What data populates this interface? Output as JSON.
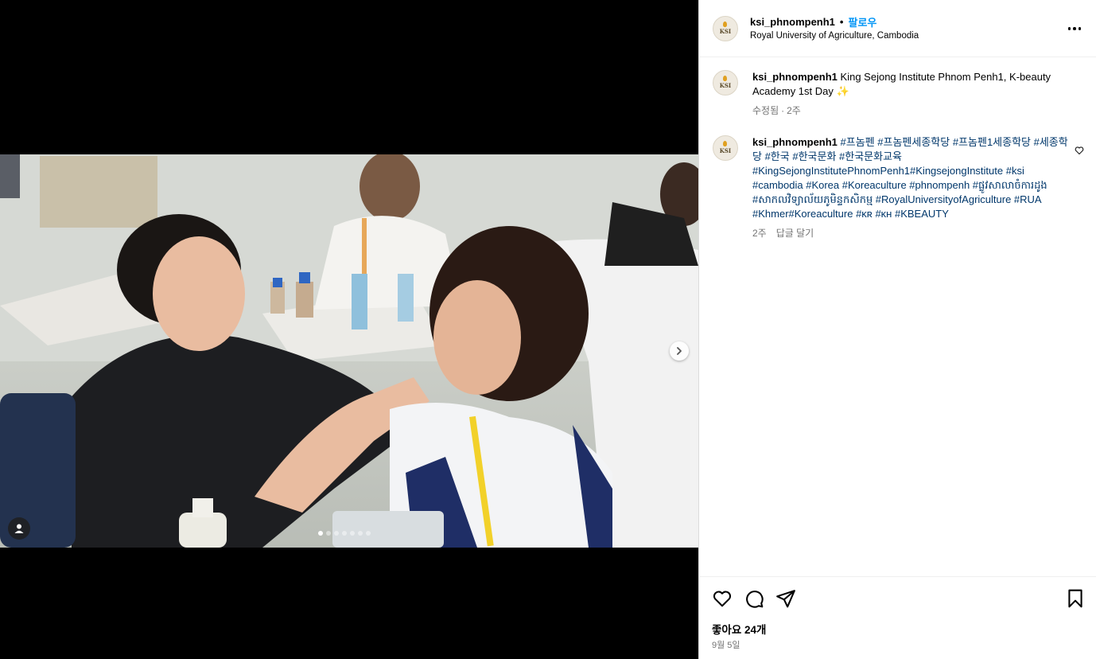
{
  "post": {
    "username": "ksi_phnompenh1",
    "separator": "•",
    "follow_label": "팔로우",
    "location": "Royal University of Agriculture, Cambodia",
    "avatar_text": "KSI"
  },
  "caption": {
    "username": "ksi_phnompenh1",
    "text": "King Sejong Institute Phnom Penh1, K-beauty Academy 1st Day ✨",
    "edited": "수정됨",
    "meta_sep": "·",
    "age": "2주"
  },
  "hashtag_comment": {
    "username": "ksi_phnompenh1",
    "tags": "#프놈펜 #프놈펜세종학당 #프놈펜1세종학당 #세종학당 #한국 #한국문화 #한국문화교육 #KingSejongInstitutePhnomPenh1#KingsejongInstitute #ksi #cambodia #Korea #Koreaculture #phnompenh #ផ្លូវសាលាចំការដូង #សាកលវិទ្យាល័យភូមិន្ទកសិកម្ម #RoyalUniversityofAgriculture #RUA #Khmer#Koreaculture #ᴋʀ #ᴋʜ #KBEAUTY",
    "age": "2주",
    "reply_label": "답글 달기"
  },
  "stats": {
    "likes": "좋아요 24개",
    "date": "9월 5일"
  },
  "carousel": {
    "total": 7,
    "active_index": 0
  },
  "icons": {
    "like": "heart-icon",
    "comment": "comment-icon",
    "share": "paper-plane-icon",
    "save": "bookmark-icon",
    "more": "more-horizontal-icon",
    "next": "chevron-right-icon",
    "tag": "user-tag-icon"
  },
  "colors": {
    "follow": "#0095f6",
    "hashtag": "#00376b",
    "meta": "#737373"
  }
}
